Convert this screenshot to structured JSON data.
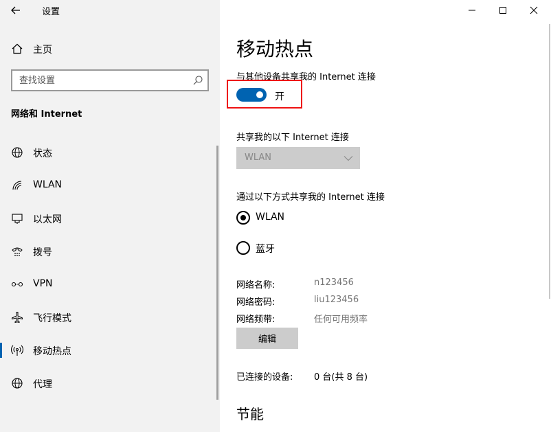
{
  "window": {
    "app_title": "设置",
    "controls": [
      "minimize-icon",
      "maximize-icon",
      "close-icon"
    ]
  },
  "sidebar": {
    "home_label": "主页",
    "search": {
      "placeholder": "查找设置",
      "value": ""
    },
    "section_title": "网络和 Internet",
    "items": [
      {
        "label": "状态",
        "icon": "globe-icon",
        "active": false
      },
      {
        "label": "WLAN",
        "icon": "wifi-icon",
        "active": false
      },
      {
        "label": "以太网",
        "icon": "ethernet-icon",
        "active": false
      },
      {
        "label": "拨号",
        "icon": "dialup-icon",
        "active": false
      },
      {
        "label": "VPN",
        "icon": "vpn-icon",
        "active": false
      },
      {
        "label": "飞行模式",
        "icon": "airplane-icon",
        "active": false
      },
      {
        "label": "移动热点",
        "icon": "hotspot-icon",
        "active": true
      },
      {
        "label": "代理",
        "icon": "globe-icon",
        "active": false
      }
    ]
  },
  "main": {
    "page_title": "移动热点",
    "share_toggle": {
      "label": "与其他设备共享我的 Internet 连接",
      "state": "开",
      "on": true
    },
    "share_from": {
      "label": "共享我的以下 Internet 连接",
      "selected": "WLAN"
    },
    "share_over": {
      "label": "通过以下方式共享我的 Internet 连接",
      "options": [
        {
          "label": "WLAN",
          "checked": true
        },
        {
          "label": "蓝牙",
          "checked": false
        }
      ]
    },
    "properties": [
      {
        "label": "网络名称:",
        "value": "n123456"
      },
      {
        "label": "网络密码:",
        "value": "liu123456"
      },
      {
        "label": "网络频带:",
        "value": "任何可用频率"
      }
    ],
    "edit_button": "编辑",
    "connected": {
      "label": "已连接的设备:",
      "value": "0 台(共 8 台)"
    },
    "power_title": "节能"
  },
  "colors": {
    "accent": "#0063b1",
    "highlight": "#ee1111",
    "sidebar_bg": "#f2f2f2"
  }
}
